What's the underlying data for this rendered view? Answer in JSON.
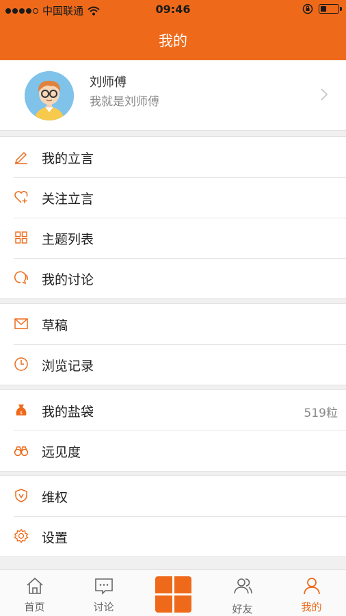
{
  "status_bar": {
    "carrier": "中国联通",
    "time": "09:46",
    "signal_icon": "signal-dots-icon",
    "wifi_icon": "wifi-icon",
    "lock_icon": "orientation-lock-icon",
    "battery_icon": "battery-icon",
    "battery_level": 0.35
  },
  "header": {
    "title": "我的"
  },
  "profile": {
    "name": "刘师傅",
    "bio": "我就是刘师傅",
    "avatar_icon": "avatar-cartoon-glasses",
    "chevron_icon": "chevron-right-icon"
  },
  "menu_groups": [
    [
      {
        "label": "我的立言",
        "icon": "pencil-icon"
      },
      {
        "label": "关注立言",
        "icon": "heart-plus-icon"
      },
      {
        "label": "主题列表",
        "icon": "grid-icon"
      },
      {
        "label": "我的讨论",
        "icon": "chat-bubbles-icon"
      }
    ],
    [
      {
        "label": "草稿",
        "icon": "envelope-icon"
      },
      {
        "label": "浏览记录",
        "icon": "clock-icon"
      }
    ],
    [
      {
        "label": "我的盐袋",
        "icon": "salt-bag-icon",
        "extra": "519粒"
      },
      {
        "label": "远见度",
        "icon": "binoculars-icon"
      }
    ],
    [
      {
        "label": "维权",
        "icon": "shield-v-icon"
      },
      {
        "label": "设置",
        "icon": "gear-icon"
      }
    ]
  ],
  "tab_bar": {
    "tabs": [
      {
        "label": "首页",
        "icon": "home-icon"
      },
      {
        "label": "讨论",
        "icon": "comment-icon"
      },
      {
        "label": "",
        "icon": "publish-grid-icon"
      },
      {
        "label": "好友",
        "icon": "friends-icon"
      },
      {
        "label": "我的",
        "icon": "person-icon"
      }
    ],
    "active_tab": "我的"
  },
  "colors": {
    "accent": "#ee6a1a",
    "background": "#f0f0f0",
    "text": "#222222",
    "muted": "#888888"
  }
}
